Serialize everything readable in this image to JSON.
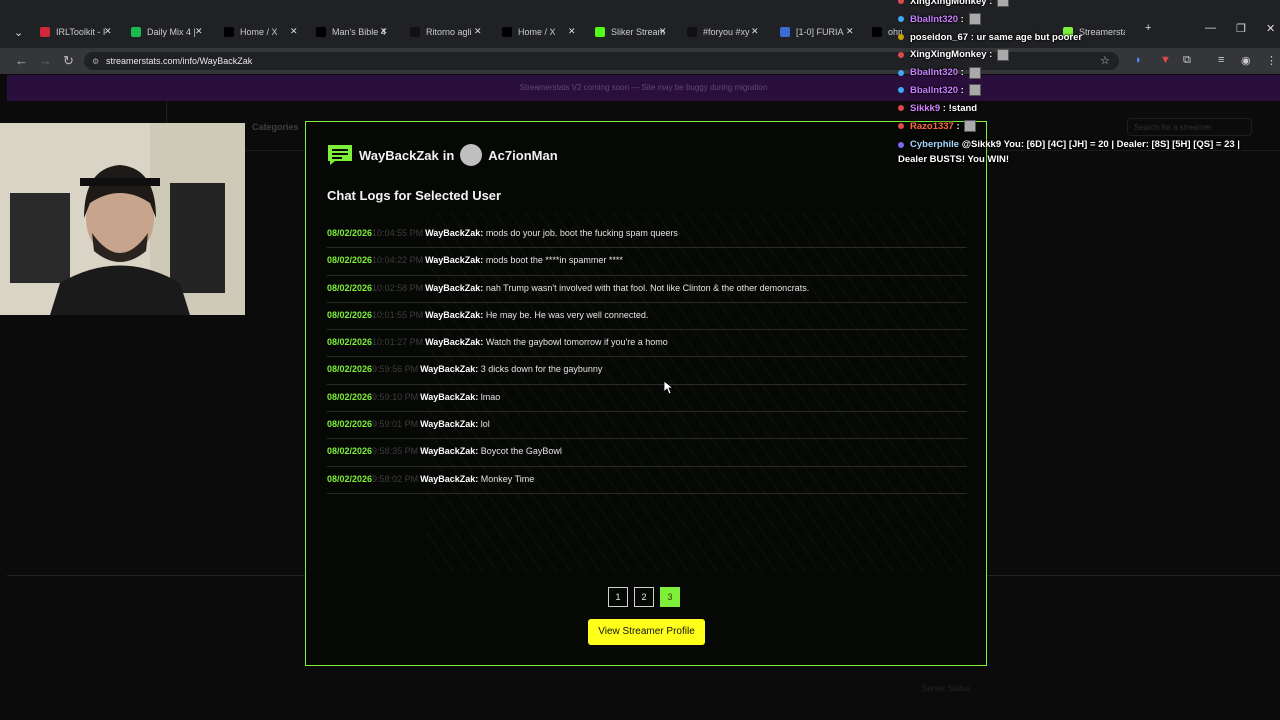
{
  "tabs": [
    {
      "title": "IRLToolkit - I",
      "icon_color": "#d0273b"
    },
    {
      "title": "Daily Mix 4 |",
      "icon_color": "#1db954"
    },
    {
      "title": "Home / X",
      "icon_color": "#000000"
    },
    {
      "title": "Man's Bible 4",
      "icon_color": "#000000"
    },
    {
      "title": "Ritorno agli",
      "icon_color": "#111111"
    },
    {
      "title": "Home / X",
      "icon_color": "#000000"
    },
    {
      "title": "Sliker Stream",
      "icon_color": "#53fc18"
    },
    {
      "title": "#foryou #xy",
      "icon_color": "#111111"
    },
    {
      "title": "[1-0] FURIA",
      "icon_color": "#3b6cd1"
    },
    {
      "title": "ohm",
      "icon_color": "#000000"
    },
    {
      "title": "Streamerstats",
      "icon_color": "#7ef03a"
    }
  ],
  "browser": {
    "url": "streamerstats.com/info/WayBackZak"
  },
  "page": {
    "banner": "Streamerstats V2 coming soon — Site may be buggy during migration",
    "categories_label": "Categories",
    "search_placeholder": "Search for a streamer",
    "footer_left": "",
    "footer_right": "Server Status"
  },
  "modal": {
    "username": "WayBackZak",
    "in_word": "in",
    "channel": "Ac7ionMan",
    "title": "Chat Logs for Selected User",
    "logs": [
      {
        "date": "08/02/2026",
        "time": "10:04:55 PM",
        "user": "WayBackZak:",
        "message": "mods do your job. boot the fucking spam queers"
      },
      {
        "date": "08/02/2026",
        "time": "10:04:22 PM",
        "user": "WayBackZak:",
        "message": "mods boot the ****in spammer ****"
      },
      {
        "date": "08/02/2026",
        "time": "10:02:58 PM",
        "user": "WayBackZak:",
        "message": "nah Trump wasn't involved with that fool. Not like Clinton & the other demoncrats."
      },
      {
        "date": "08/02/2026",
        "time": "10:01:55 PM",
        "user": "WayBackZak:",
        "message": "He may be. He was very well connected."
      },
      {
        "date": "08/02/2026",
        "time": "10:01:27 PM",
        "user": "WayBackZak:",
        "message": "Watch the gaybowl tomorrow if you're a homo"
      },
      {
        "date": "08/02/2026",
        "time": "9:59:56 PM",
        "user": "WayBackZak:",
        "message": "3 dicks down for the gaybunny"
      },
      {
        "date": "08/02/2026",
        "time": "9:59:10 PM",
        "user": "WayBackZak:",
        "message": "lmao"
      },
      {
        "date": "08/02/2026",
        "time": "9:59:01 PM",
        "user": "WayBackZak:",
        "message": "lol"
      },
      {
        "date": "08/02/2026",
        "time": "9:58:35 PM",
        "user": "WayBackZak:",
        "message": "Boycot the GayBowl"
      },
      {
        "date": "08/02/2026",
        "time": "9:58:02 PM",
        "user": "WayBackZak:",
        "message": "Monkey Time"
      }
    ],
    "pages": [
      "1",
      "2",
      "3"
    ],
    "active_page": "3",
    "view_profile_label": "View Streamer Profile"
  },
  "stream_chat": [
    {
      "user": "XingXingMonkey",
      "color": "#ffffff",
      "badge": "#e0484c",
      "message": "",
      "emote": true
    },
    {
      "user": "Bballnt320",
      "color": "#c77dff",
      "badge": "#3fa9f5",
      "message": "",
      "emote": true
    },
    {
      "user": "poseidon_67",
      "color": "#ffffff",
      "badge": "#c8a000",
      "message": "ur same age but poorer",
      "emote": false
    },
    {
      "user": "XingXingMonkey",
      "color": "#ffffff",
      "badge": "#e0484c",
      "message": "",
      "emote": true
    },
    {
      "user": "Bballnt320",
      "color": "#c77dff",
      "badge": "#3fa9f5",
      "message": "",
      "emote": true
    },
    {
      "user": "Bballnt320",
      "color": "#c77dff",
      "badge": "#3fa9f5",
      "message": "",
      "emote": true
    },
    {
      "user": "Sikkk9",
      "color": "#d580ff",
      "badge": "#e0484c",
      "message": "!stand",
      "emote": false
    },
    {
      "user": "Razo1337",
      "color": "#ff6a3d",
      "badge": "#e0484c",
      "message": "",
      "emote": true
    }
  ],
  "stream_chat_last": {
    "user": "Cyberphile",
    "color": "#a5d8ff",
    "message": "@Sikkk9 You: [6D] [4C] [JH] = 20 | Dealer: [8S] [5H] [QS] = 23 | Dealer BUSTS! You WIN!"
  },
  "colors": {
    "accent": "#7ef03a",
    "button": "#ffff1a",
    "banner_bg": "#2a0f3d"
  }
}
